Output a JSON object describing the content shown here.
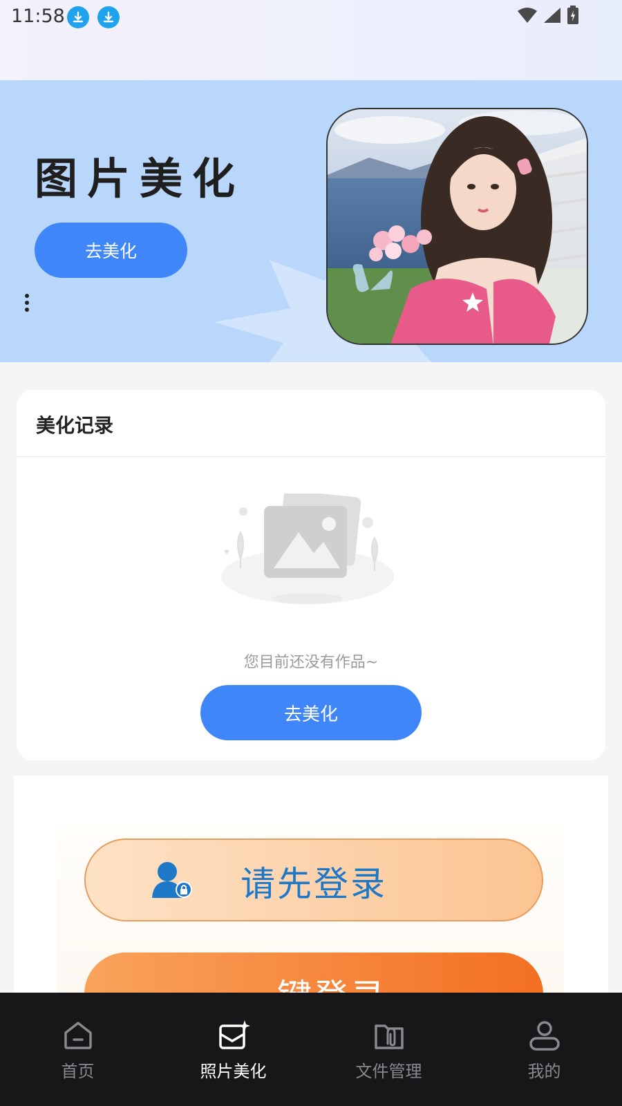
{
  "status_bar": {
    "time": "11:58"
  },
  "banner": {
    "title": "图片美化",
    "button_label": "去美化"
  },
  "record": {
    "title": "美化记录",
    "empty_text": "您目前还没有作品~",
    "button_label": "去美化"
  },
  "login_ad": {
    "prompt_label": "请先登录",
    "onekey_label": "一键登录"
  },
  "bottom_nav": {
    "items": [
      {
        "label": "首页",
        "icon": "home-icon",
        "active": false
      },
      {
        "label": "照片美化",
        "icon": "photo-sparkle-icon",
        "active": true
      },
      {
        "label": "文件管理",
        "icon": "folder-clip-icon",
        "active": false
      },
      {
        "label": "我的",
        "icon": "profile-icon",
        "active": false
      }
    ]
  },
  "colors": {
    "accent": "#3f86f8",
    "banner_bg": "#b9d6fb",
    "nav_bg": "#17171a"
  }
}
